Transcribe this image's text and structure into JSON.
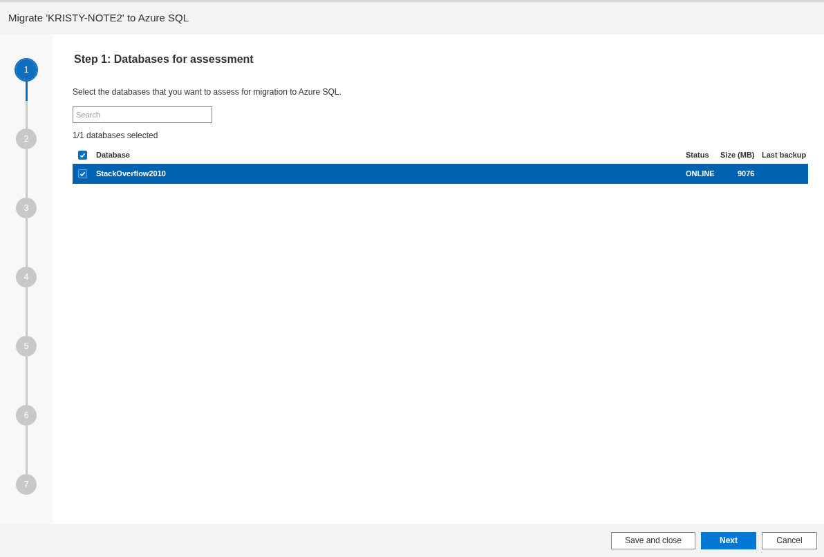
{
  "window": {
    "title": "Migrate 'KRISTY-NOTE2' to Azure SQL"
  },
  "steps": [
    {
      "label": "1",
      "selected": true
    },
    {
      "label": "2",
      "selected": false
    },
    {
      "label": "3",
      "selected": false
    },
    {
      "label": "4",
      "selected": false
    },
    {
      "label": "5",
      "selected": false
    },
    {
      "label": "6",
      "selected": false
    },
    {
      "label": "7",
      "selected": false
    }
  ],
  "page": {
    "heading": "Step 1: Databases for assessment",
    "description": "Select the databases that you want to assess for migration to Azure SQL.",
    "search": {
      "placeholder": "Search"
    },
    "selection_count": "1/1 databases selected"
  },
  "table": {
    "all_checked": true,
    "columns": [
      "Database",
      "Status",
      "Size (MB)",
      "Last backup"
    ],
    "rows": [
      {
        "cells": [
          "StackOverflow2010",
          "ONLINE",
          "9076",
          ""
        ],
        "checked": true,
        "selected": true
      }
    ]
  },
  "buttons": [
    {
      "label": "Save and close",
      "kind": "secondary"
    },
    {
      "label": "Next",
      "kind": "primary"
    },
    {
      "label": "Cancel",
      "kind": "secondary"
    }
  ]
}
